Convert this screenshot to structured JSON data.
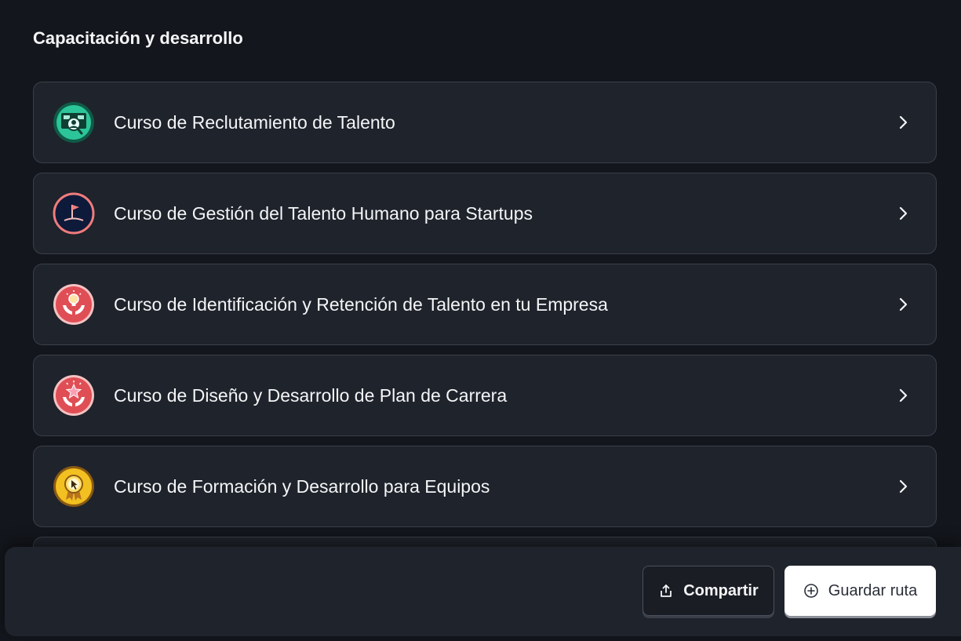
{
  "section": {
    "title": "Capacitación y desarrollo"
  },
  "courses": [
    {
      "title": "Curso de Reclutamiento de Talento",
      "badge_icon": "recruitment-badge-icon",
      "badge_color": "#1fb08a"
    },
    {
      "title": "Curso de Gestión del Talento Humano para Startups",
      "badge_icon": "flag-badge-icon",
      "badge_color": "#0e1a3a"
    },
    {
      "title": "Curso de Identificación y Retención de Talento en tu Empresa",
      "badge_icon": "lightbulb-hands-badge-icon",
      "badge_color": "#e04e55"
    },
    {
      "title": "Curso de Diseño y Desarrollo de Plan de Carrera",
      "badge_icon": "star-hands-badge-icon",
      "badge_color": "#e04e55"
    },
    {
      "title": "Curso de Formación y Desarrollo para Equipos",
      "badge_icon": "award-badge-icon",
      "badge_color": "#f2c020"
    }
  ],
  "actions": {
    "share_label": "Compartir",
    "save_label": "Guardar ruta"
  },
  "colors": {
    "background": "#13161c",
    "card": "#1f232b",
    "card_border": "#3a3f4a",
    "text": "#f4f5f7"
  }
}
